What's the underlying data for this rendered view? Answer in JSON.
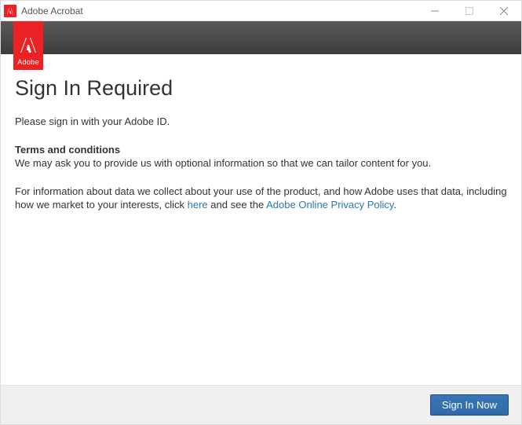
{
  "titlebar": {
    "title": "Adobe Acrobat"
  },
  "brand": {
    "label": "Adobe"
  },
  "main": {
    "heading": "Sign In Required",
    "intro": "Please sign in with your Adobe ID.",
    "terms_heading": "Terms and conditions",
    "terms_body": "We may ask you to provide us with optional information so that we can tailor content for you.",
    "data_text_1": "For information about data we collect about your use of the product, and how Adobe uses that data, including how we market to your interests, click ",
    "data_link_here": "here",
    "data_text_2": " and see the ",
    "data_link_policy": "Adobe Online Privacy Policy",
    "data_text_3": "."
  },
  "footer": {
    "sign_in_label": "Sign In Now"
  }
}
